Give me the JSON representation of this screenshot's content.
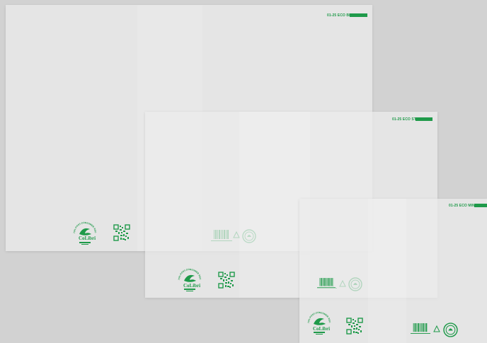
{
  "colors": {
    "background": "#d2d2d2",
    "print_green": "#1f9a4a"
  },
  "bags": [
    {
      "name": "large",
      "code": "01-25 ECO BIG",
      "brand": "CoLibri",
      "arc_text": "70% POST-CONSUMER RECYCLED"
    },
    {
      "name": "medium",
      "code": "01-25 ECO STD",
      "brand": "CoLibri",
      "arc_text": "70% POST-CONSUMER RECYCLED"
    },
    {
      "name": "small",
      "code": "01-25 ECO MINI",
      "brand": "CoLibri",
      "arc_text": "70% POST-CONSUMER RECYCLED"
    }
  ],
  "icons": [
    "colibri-logo-icon",
    "qr-code-icon",
    "barcode-icon",
    "recycle-triangle-icon",
    "recycling-seal-icon"
  ]
}
